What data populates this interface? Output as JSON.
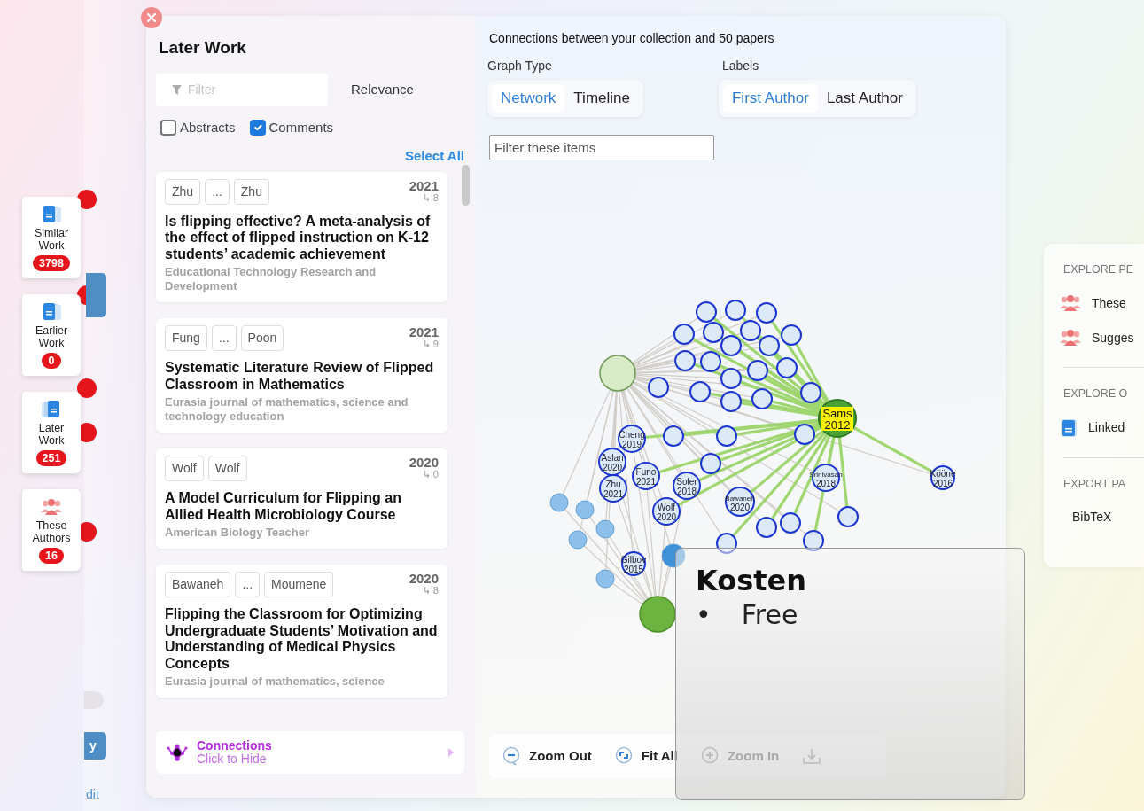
{
  "sidebar": {
    "items": [
      {
        "kind": "similar",
        "label": "Similar Work",
        "count": "3798"
      },
      {
        "kind": "earlier",
        "label": "Earlier Work",
        "count": "0"
      },
      {
        "kind": "later",
        "label": "Later Work",
        "count": "251"
      },
      {
        "kind": "people",
        "label": "These Authors",
        "count": "16"
      }
    ]
  },
  "back_strip": {
    "toggle_on": false,
    "button_label": "y",
    "link_label": "dit"
  },
  "list": {
    "title": "Later Work",
    "filter_placeholder": "Filter",
    "sort": "Relevance",
    "toggles": [
      {
        "label": "Abstracts",
        "checked": false
      },
      {
        "label": "Comments",
        "checked": true
      }
    ],
    "select_all": "Select All",
    "papers": [
      {
        "authors": [
          "Zhu",
          "...",
          "Zhu"
        ],
        "year": "2021",
        "citations": "↳ 8",
        "title": "Is flipping effective? A meta-analysis of the effect of flipped instruction on K-12 students’ academic achievement",
        "venue": "Educational Technology Research and Development"
      },
      {
        "authors": [
          "Fung",
          "...",
          "Poon"
        ],
        "year": "2021",
        "citations": "↳ 9",
        "title": "Systematic Literature Review of Flipped Classroom in Mathematics",
        "venue": "Eurasia journal of mathematics, science and technology education"
      },
      {
        "authors": [
          "Wolf",
          "Wolf"
        ],
        "year": "2020",
        "citations": "↳ 0",
        "title": "A Model Curriculum for Flipping an Allied Health Microbiology Course",
        "venue": "American Biology Teacher"
      },
      {
        "authors": [
          "Bawaneh",
          "...",
          "Moumene"
        ],
        "year": "2020",
        "citations": "↳ 8",
        "title": "Flipping the Classroom for Optimizing Undergraduate Students’ Motivation and Understanding of Medical Physics Concepts",
        "venue": "Eurasia journal of mathematics, science"
      }
    ],
    "connections": {
      "title": "Connections",
      "subtitle": "Click to Hide"
    }
  },
  "graph": {
    "heading": "Connections between your collection and 50 papers",
    "graph_type": {
      "label": "Graph Type",
      "options": [
        {
          "label": "Network",
          "selected": true
        },
        {
          "label": "Timeline",
          "selected": false
        }
      ]
    },
    "labels": {
      "label": "Labels",
      "options": [
        {
          "label": "First Author",
          "selected": true
        },
        {
          "label": "Last Author",
          "selected": false
        }
      ]
    },
    "filter_placeholder": "Filter these items",
    "nodes": [
      {
        "kind": "collection"
      },
      {
        "kind": "hub",
        "label": "Sams",
        "year": "2012"
      },
      {
        "kind": "paper",
        "label": "Cheng",
        "year": "2019"
      },
      {
        "kind": "paper",
        "label": "Aslan",
        "year": "2020"
      },
      {
        "kind": "paper",
        "label": "Zhu",
        "year": "2021"
      },
      {
        "kind": "paper",
        "label": "Funo",
        "year": "2021"
      },
      {
        "kind": "paper",
        "label": "Soler",
        "year": "2018"
      },
      {
        "kind": "paper",
        "label": "Wolf",
        "year": "2020"
      },
      {
        "kind": "paper",
        "label": "Bawaneh",
        "year": "2020"
      },
      {
        "kind": "paper",
        "label": "Srinivasan",
        "year": "2018"
      },
      {
        "kind": "paper",
        "label": "Kööne",
        "year": "2016"
      },
      {
        "kind": "paper",
        "label": "Gilbov",
        "year": "2015"
      },
      {
        "kind": "small"
      },
      {
        "kind": "small"
      },
      {
        "kind": "small"
      },
      {
        "kind": "small"
      },
      {
        "kind": "small"
      },
      {
        "kind": "small"
      },
      {
        "kind": "small"
      },
      {
        "kind": "small"
      },
      {
        "kind": "small"
      },
      {
        "kind": "small"
      },
      {
        "kind": "small"
      },
      {
        "kind": "small"
      },
      {
        "kind": "small"
      },
      {
        "kind": "small"
      },
      {
        "kind": "small"
      },
      {
        "kind": "small"
      },
      {
        "kind": "small"
      },
      {
        "kind": "small"
      },
      {
        "kind": "small"
      },
      {
        "kind": "small"
      },
      {
        "kind": "small"
      },
      {
        "kind": "small"
      },
      {
        "kind": "small"
      },
      {
        "kind": "small"
      },
      {
        "kind": "small"
      },
      {
        "kind": "small"
      },
      {
        "kind": "small"
      },
      {
        "kind": "small"
      },
      {
        "kind": "dot"
      },
      {
        "kind": "dot"
      },
      {
        "kind": "dot"
      },
      {
        "kind": "dot"
      },
      {
        "kind": "dot"
      },
      {
        "kind": "dot"
      },
      {
        "kind": "focus"
      }
    ],
    "toolbar": [
      {
        "kind": "zoom-out",
        "label": "Zoom Out",
        "disabled": false
      },
      {
        "kind": "fit",
        "label": "Fit All",
        "disabled": false
      },
      {
        "kind": "zoom-in",
        "label": "Zoom In",
        "disabled": true
      },
      {
        "kind": "download",
        "disabled": true
      }
    ]
  },
  "right_panel": {
    "sections": [
      {
        "heading": "EXPLORE PE",
        "items": [
          {
            "kind": "people",
            "label": "These"
          },
          {
            "kind": "people",
            "label": "Sugges"
          }
        ]
      },
      {
        "heading": "EXPLORE O",
        "items": [
          {
            "kind": "doc",
            "label": "Linked"
          }
        ]
      },
      {
        "heading": "EXPORT PA",
        "items": [
          {
            "kind": "text",
            "label": "BibTeX"
          }
        ]
      }
    ]
  },
  "tooltip": {
    "title": "Kosten",
    "items": [
      {
        "bullet": "•",
        "text": "Free"
      }
    ]
  }
}
